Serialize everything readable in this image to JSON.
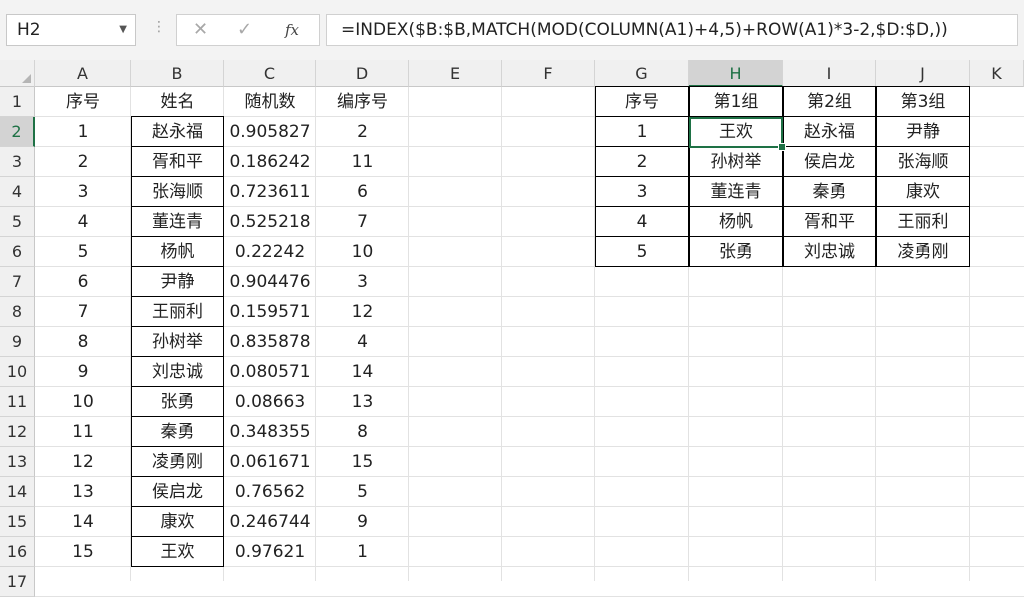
{
  "name_box": "H2",
  "formula": "=INDEX($B:$B,MATCH(MOD(COLUMN(A1)+4,5)+ROW(A1)*3-2,$D:$D,))",
  "columns": [
    "A",
    "B",
    "C",
    "D",
    "E",
    "F",
    "G",
    "H",
    "I",
    "J",
    "K"
  ],
  "rows": [
    "1",
    "2",
    "3",
    "4",
    "5",
    "6",
    "7",
    "8",
    "9",
    "10",
    "11",
    "12",
    "13",
    "14",
    "15",
    "16",
    "17"
  ],
  "left_table": {
    "headers": [
      "序号",
      "姓名",
      "随机数",
      "编序号"
    ],
    "rows": [
      [
        "1",
        "赵永福",
        "0.905827",
        "2"
      ],
      [
        "2",
        "胥和平",
        "0.186242",
        "11"
      ],
      [
        "3",
        "张海顺",
        "0.723611",
        "6"
      ],
      [
        "4",
        "董连青",
        "0.525218",
        "7"
      ],
      [
        "5",
        "杨帆",
        "0.22242",
        "10"
      ],
      [
        "6",
        "尹静",
        "0.904476",
        "3"
      ],
      [
        "7",
        "王丽利",
        "0.159571",
        "12"
      ],
      [
        "8",
        "孙树举",
        "0.835878",
        "4"
      ],
      [
        "9",
        "刘忠诚",
        "0.080571",
        "14"
      ],
      [
        "10",
        "张勇",
        "0.08663",
        "13"
      ],
      [
        "11",
        "秦勇",
        "0.348355",
        "8"
      ],
      [
        "12",
        "凌勇刚",
        "0.061671",
        "15"
      ],
      [
        "13",
        "侯启龙",
        "0.76562",
        "5"
      ],
      [
        "14",
        "康欢",
        "0.246744",
        "9"
      ],
      [
        "15",
        "王欢",
        "0.97621",
        "1"
      ]
    ]
  },
  "right_table": {
    "headers": [
      "序号",
      "第1组",
      "第2组",
      "第3组"
    ],
    "rows": [
      [
        "1",
        "王欢",
        "赵永福",
        "尹静"
      ],
      [
        "2",
        "孙树举",
        "侯启龙",
        "张海顺"
      ],
      [
        "3",
        "董连青",
        "秦勇",
        "康欢"
      ],
      [
        "4",
        "杨帆",
        "胥和平",
        "王丽利"
      ],
      [
        "5",
        "张勇",
        "刘忠诚",
        "凌勇刚"
      ]
    ]
  },
  "icons": {
    "cancel": "✕",
    "enter": "✓",
    "function": "fx",
    "dropdown": "▼",
    "separator": "⋮"
  },
  "colors": {
    "accent": "#1e7145",
    "header_bg": "#f0f0f0",
    "selected_header_bg": "#d3d3d3"
  }
}
